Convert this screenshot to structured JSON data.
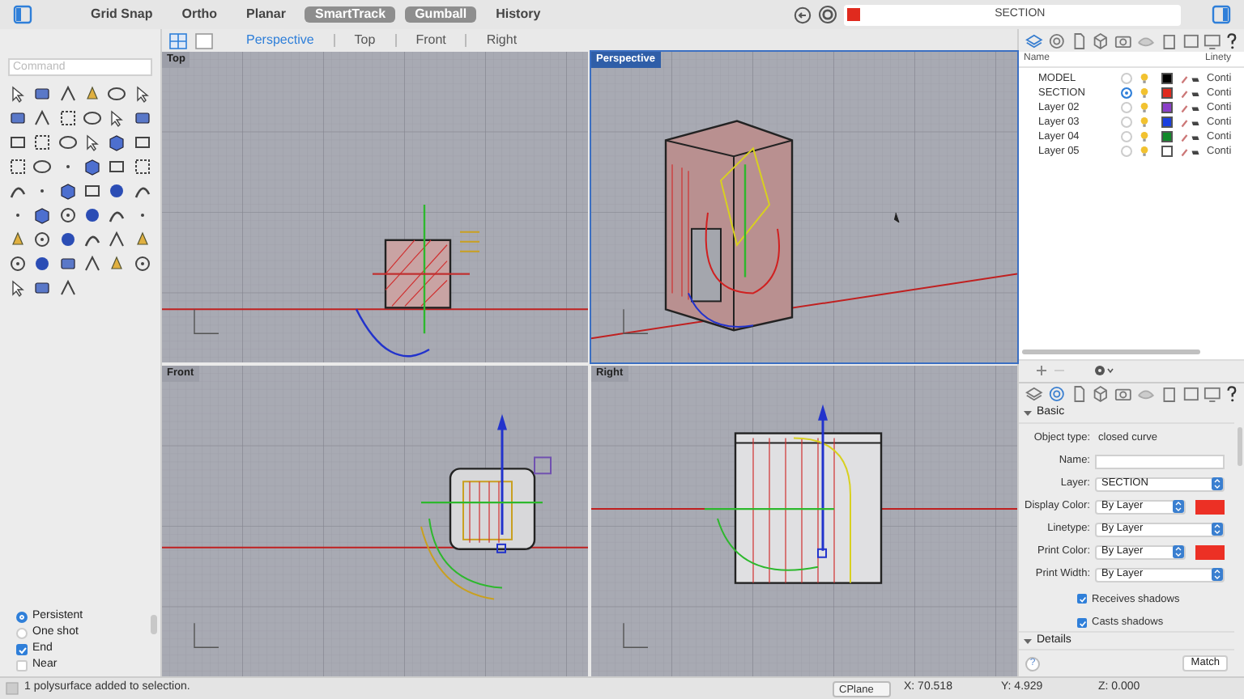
{
  "toolbar": {
    "toggles": [
      {
        "label": "Grid Snap",
        "on": false
      },
      {
        "label": "Ortho",
        "on": false
      },
      {
        "label": "Planar",
        "on": false
      },
      {
        "label": "SmartTrack",
        "on": true
      },
      {
        "label": "Gumball",
        "on": true
      },
      {
        "label": "History",
        "on": false
      }
    ],
    "current_layer": "SECTION"
  },
  "command": {
    "placeholder": "Command"
  },
  "osnap": {
    "modes": [
      {
        "label": "Persistent",
        "selected": true
      },
      {
        "label": "One shot",
        "selected": false
      }
    ],
    "snaps": [
      {
        "label": "End",
        "checked": true
      },
      {
        "label": "Near",
        "checked": false
      }
    ]
  },
  "viewport_tabs": [
    {
      "label": "Perspective",
      "selected": true
    },
    {
      "label": "Top",
      "selected": false
    },
    {
      "label": "Front",
      "selected": false
    },
    {
      "label": "Right",
      "selected": false
    }
  ],
  "viewports": [
    {
      "title": "Top",
      "active": false,
      "kind": "top"
    },
    {
      "title": "Perspective",
      "active": true,
      "kind": "perspective"
    },
    {
      "title": "Front",
      "active": false,
      "kind": "front"
    },
    {
      "title": "Right",
      "active": false,
      "kind": "right"
    }
  ],
  "layers": {
    "columns": [
      "Name",
      "Linety"
    ],
    "rows": [
      {
        "name": "MODEL",
        "current": false,
        "color": "#000000",
        "linetype": "Conti"
      },
      {
        "name": "SECTION",
        "current": true,
        "color": "#e02a1e",
        "linetype": "Conti"
      },
      {
        "name": "Layer 02",
        "current": false,
        "color": "#8b3fc9",
        "linetype": "Conti"
      },
      {
        "name": "Layer 03",
        "current": false,
        "color": "#1a3fe0",
        "linetype": "Conti"
      },
      {
        "name": "Layer 04",
        "current": false,
        "color": "#12892a",
        "linetype": "Conti"
      },
      {
        "name": "Layer 05",
        "current": false,
        "color": "#ffffff",
        "linetype": "Conti"
      }
    ]
  },
  "properties": {
    "section": "Basic",
    "fields": [
      {
        "label": "Object type:",
        "kind": "text",
        "value": "closed curve"
      },
      {
        "label": "Name:",
        "kind": "input"
      },
      {
        "label": "Layer:",
        "kind": "select",
        "value": "SECTION"
      },
      {
        "label": "Display Color:",
        "kind": "color",
        "value": "By Layer"
      },
      {
        "label": "Linetype:",
        "kind": "select",
        "value": "By Layer"
      },
      {
        "label": "Print Color:",
        "kind": "color",
        "value": "By Layer"
      },
      {
        "label": "Print Width:",
        "kind": "select",
        "value": "By Layer"
      }
    ],
    "checkboxes": [
      {
        "label": "Receives shadows",
        "checked": true
      },
      {
        "label": "Casts shadows",
        "checked": true
      }
    ],
    "details": "Details",
    "help": "?",
    "match": "Match"
  },
  "status": {
    "message": "1 polysurface added to selection.",
    "cplane": "CPlane",
    "x": "X: 70.518",
    "y": "Y: 4.929",
    "z": "Z: 0.000"
  }
}
